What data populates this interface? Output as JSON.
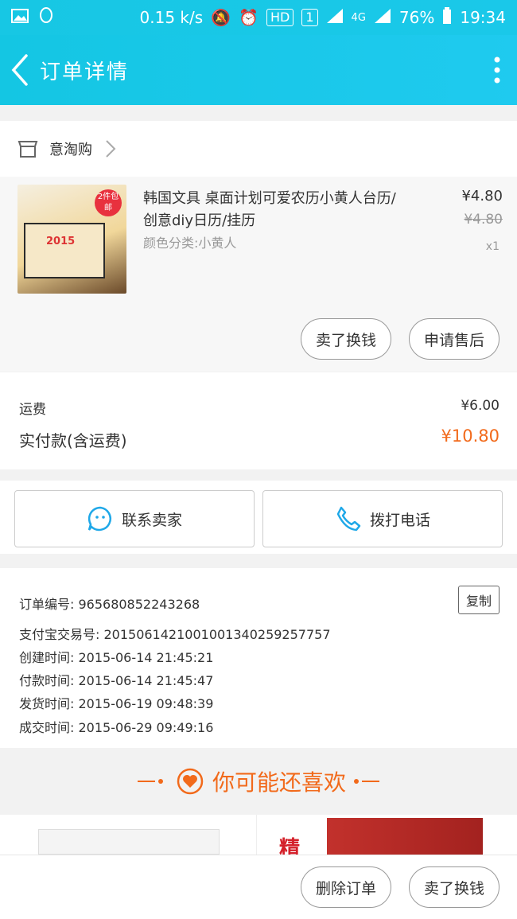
{
  "status_bar": {
    "speed": "0.15 k/s",
    "hd": "HD",
    "sim": "1",
    "net": "4G",
    "battery": "76%",
    "time": "19:34"
  },
  "header": {
    "title": "订单详情"
  },
  "shop": {
    "name": "意淘购"
  },
  "item": {
    "title": "韩国文具 桌面计划可爱农历小黄人台历/创意diy日历/挂历",
    "variant": "颜色分类:小黄人",
    "price": "¥4.80",
    "original_price": "¥4.80",
    "quantity": "x1",
    "image_year": "2015",
    "image_badge": "2件包邮",
    "sell_label": "卖了换钱",
    "aftersale_label": "申请售后"
  },
  "fees": {
    "shipping_label": "运费",
    "shipping_value": "¥6.00",
    "paid_label": "实付款(含运费)",
    "paid_value": "¥10.80"
  },
  "contact": {
    "seller_label": "联系卖家",
    "call_label": "拨打电话"
  },
  "order_info": {
    "order_no": "订单编号: 965680852243268",
    "alipay_no": "支付宝交易号: 2015061421001001340259257757",
    "created": "创建时间: 2015-06-14 21:45:21",
    "paid": "付款时间: 2015-06-14 21:45:47",
    "shipped": "发货时间: 2015-06-19 09:48:39",
    "completed": "成交时间: 2015-06-29 09:49:16",
    "copy_label": "复制"
  },
  "recommend": {
    "title": "你可能还喜欢",
    "product2_char": "精"
  },
  "bottom_bar": {
    "delete_label": "删除订单",
    "sell_label": "卖了换钱"
  },
  "colors": {
    "header": "#17c7e4",
    "accent": "#f26a1b"
  }
}
